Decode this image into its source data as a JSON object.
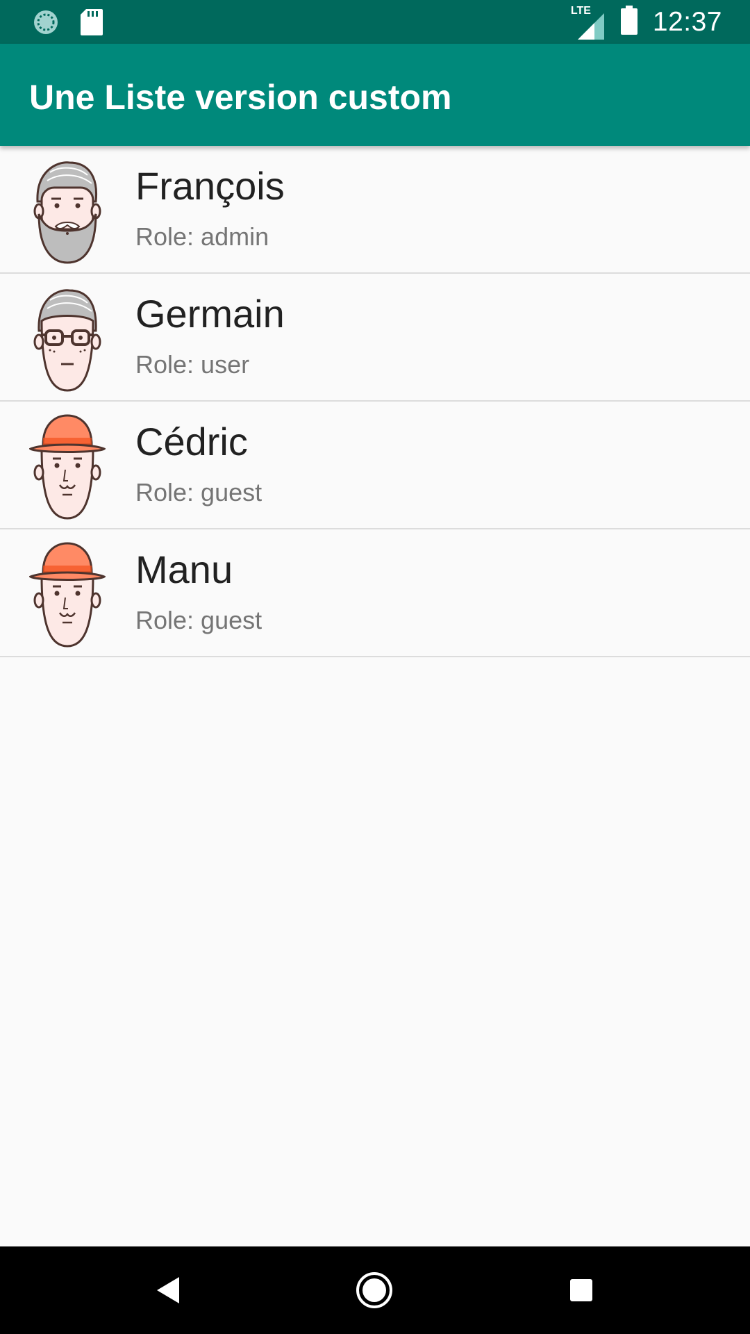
{
  "status_bar": {
    "time": "12:37",
    "network": "LTE",
    "icons": [
      "sync-icon",
      "sd-card-icon",
      "signal-icon",
      "battery-icon"
    ]
  },
  "app_bar": {
    "title": "Une Liste version custom",
    "color": "#00897b"
  },
  "users": [
    {
      "name": "François",
      "role": "Role: admin",
      "avatar": "bearded-man-avatar"
    },
    {
      "name": "Germain",
      "role": "Role: user",
      "avatar": "glasses-man-avatar"
    },
    {
      "name": "Cédric",
      "role": "Role: guest",
      "avatar": "hat-man-avatar"
    },
    {
      "name": "Manu",
      "role": "Role: guest",
      "avatar": "hat-man-avatar"
    }
  ],
  "nav_bar": {
    "buttons": [
      "back-icon",
      "home-icon",
      "recents-icon"
    ]
  },
  "colors": {
    "status_bar": "#00695c",
    "accent": "#00897b",
    "hat": "#ff8a65"
  }
}
